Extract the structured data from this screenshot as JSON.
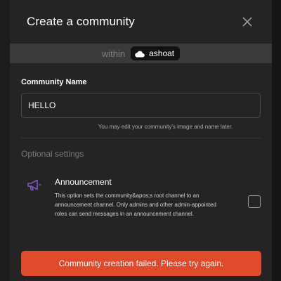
{
  "modal": {
    "title": "Create a community",
    "within_label": "within",
    "parent_community": "ashoat",
    "community_name_label": "Community Name",
    "community_name_value": "HELLO",
    "hint": "You may edit your community's image and name later.",
    "optional_settings_title": "Optional settings",
    "announcement": {
      "title": "Announcement",
      "description": "This option sets the community&apos;s root channel to an announcement channel. Only admins and other admin-appointed roles can send messages in an announcement channel.",
      "checked": false
    },
    "error_button_label": "Community creation failed. Please try again."
  },
  "colors": {
    "background": "#141414",
    "modal": "#242424",
    "within_bar": "#3a3a3a",
    "error": "#e04a2c",
    "icon_accent": "#7e57c2"
  },
  "icons": {
    "close": "close-icon",
    "parent": "cloud-icon",
    "announcement": "megaphone-icon"
  }
}
